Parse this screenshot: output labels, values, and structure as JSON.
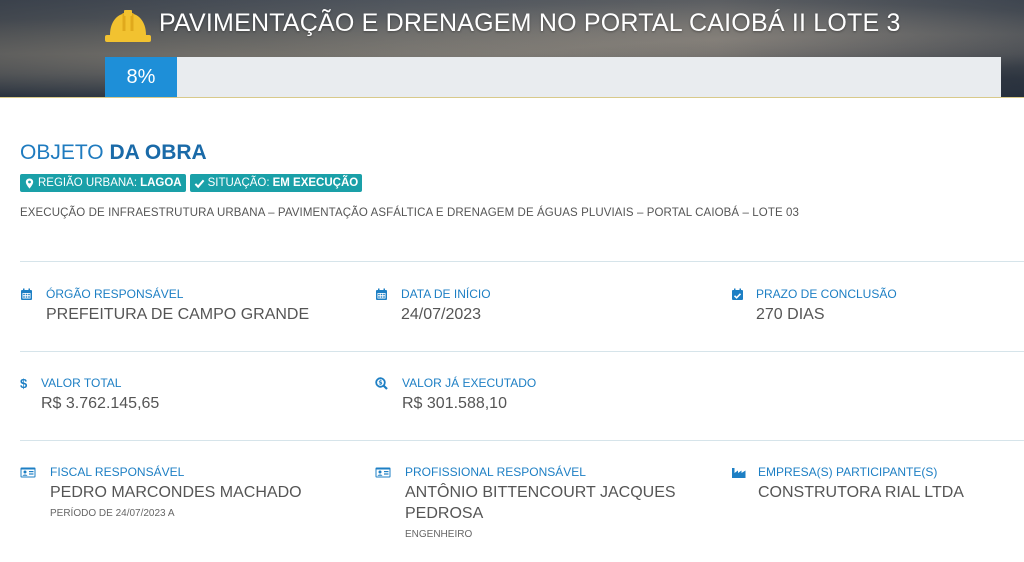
{
  "header": {
    "title": "PAVIMENTAÇÃO E DRENAGEM NO PORTAL CAIOBÁ II LOTE 3",
    "progress_percent": 8,
    "progress_label": "8%",
    "icon": "hard-hat-icon"
  },
  "section": {
    "title_light": "OBJETO",
    "title_bold": "DA OBRA"
  },
  "badges": [
    {
      "icon": "map-marker-icon",
      "label": "REGIÃO URBANA:",
      "value": "LAGOA"
    },
    {
      "icon": "check-icon",
      "label": "SITUAÇÃO:",
      "value": "EM EXECUÇÃO"
    }
  ],
  "description": "EXECUÇÃO DE INFRAESTRUTURA URBANA – PAVIMENTAÇÃO ASFÁLTICA E DRENAGEM DE ÁGUAS PLUVIAIS – PORTAL CAIOBÁ – LOTE 03",
  "fields": {
    "orgao": {
      "icon": "calendar-icon",
      "label": "ÓRGÃO RESPONSÁVEL",
      "value": "PREFEITURA DE CAMPO GRANDE"
    },
    "data_inicio": {
      "icon": "calendar-icon",
      "label": "DATA DE INÍCIO",
      "value": "24/07/2023"
    },
    "prazo": {
      "icon": "calendar-check-icon",
      "label": "PRAZO DE CONCLUSÃO",
      "value": "270 DIAS"
    },
    "valor_total": {
      "icon": "dollar-icon",
      "label": "VALOR TOTAL",
      "value": "R$ 3.762.145,65"
    },
    "valor_executado": {
      "icon": "search-dollar-icon",
      "label": "VALOR JÁ EXECUTADO",
      "value": "R$ 301.588,10"
    },
    "fiscal": {
      "icon": "id-card-icon",
      "label": "FISCAL RESPONSÁVEL",
      "value": "PEDRO MARCONDES MACHADO",
      "note": "PERÍODO DE 24/07/2023 A"
    },
    "profissional": {
      "icon": "id-card-icon",
      "label": "PROFISSIONAL RESPONSÁVEL",
      "value_line1": "ANTÔNIO BITTENCOURT JACQUES",
      "value_line2": "PEDROSA",
      "note": "ENGENHEIRO"
    },
    "empresa": {
      "icon": "industry-icon",
      "label": "EMPRESA(S) PARTICIPANTE(S)",
      "value": "CONSTRUTORA RIAL LTDA"
    }
  },
  "colors": {
    "accent": "#1d7fc4",
    "badge": "#1aa0a8",
    "progress": "#1e8fd8",
    "helmet": "#f2c230"
  }
}
